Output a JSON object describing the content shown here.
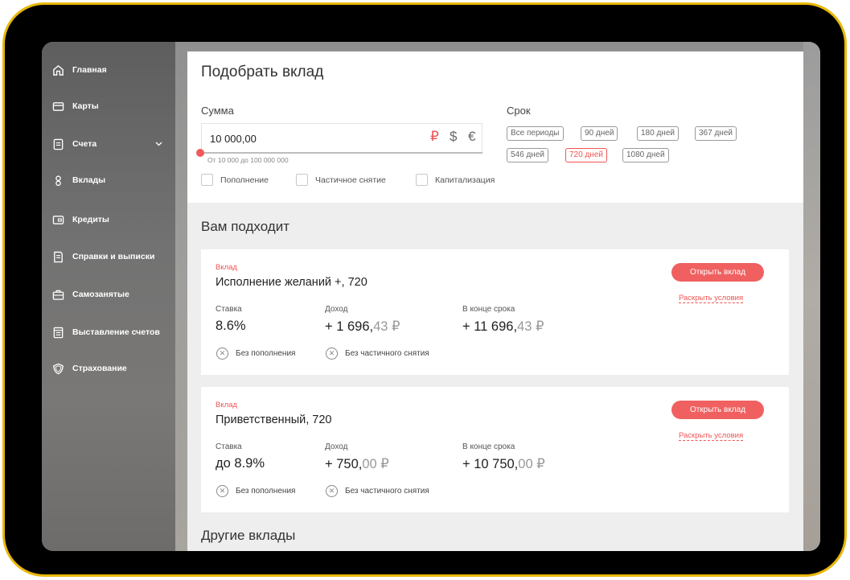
{
  "sidebar": {
    "items": [
      {
        "label": "Главная",
        "icon": "home-icon"
      },
      {
        "label": "Карты",
        "icon": "card-icon"
      },
      {
        "label": "Счета",
        "icon": "document-icon"
      },
      {
        "label": "Вклады",
        "icon": "person-icon"
      },
      {
        "label": "Кредиты",
        "icon": "wallet-icon"
      },
      {
        "label": "Справки и выписки",
        "icon": "report-icon"
      },
      {
        "label": "Самозанятые",
        "icon": "briefcase-icon"
      },
      {
        "label": "Выставление счетов",
        "icon": "invoice-icon"
      },
      {
        "label": "Страхование",
        "icon": "shield-icon"
      }
    ]
  },
  "filter": {
    "title": "Подобрать вклад",
    "amount_label": "Сумма",
    "amount_value": "10 000,00",
    "currencies": [
      "₽",
      "$",
      "€"
    ],
    "selected_currency": "₽",
    "range_hint": "От 10 000 до 100 000 000",
    "term_label": "Срок",
    "terms": [
      "Все периоды",
      "90 дней",
      "180 дней",
      "367 дней",
      "546 дней",
      "720 дней",
      "1080 дней"
    ],
    "selected_term": "720 дней",
    "options": [
      "Пополнение",
      "Частичное снятие",
      "Капитализация"
    ]
  },
  "suits_title": "Вам подходит",
  "labels": {
    "rate": "Ставка",
    "income": "Доход",
    "end_of_term": "В конце срока",
    "no_topup": "Без пополнения",
    "no_partial": "Без частичного снятия",
    "open": "Открыть вклад",
    "terms_link": "Раскрыть условия"
  },
  "deposits": [
    {
      "type": "Вклад",
      "name": "Исполнение желаний +, 720",
      "rate": "8.6%",
      "income_int": "+ 1 696,",
      "income_dec": "43 ₽",
      "end_int": "+ 11 696,",
      "end_dec": "43 ₽"
    },
    {
      "type": "Вклад",
      "name": "Приветственный, 720",
      "rate": "до 8.9%",
      "income_int": "+ 750,",
      "income_dec": "00 ₽",
      "end_int": "+ 10 750,",
      "end_dec": "00 ₽"
    }
  ],
  "other_title": "Другие вклады",
  "colors": {
    "accent": "#f05454",
    "bezel": "#e8b80a"
  }
}
